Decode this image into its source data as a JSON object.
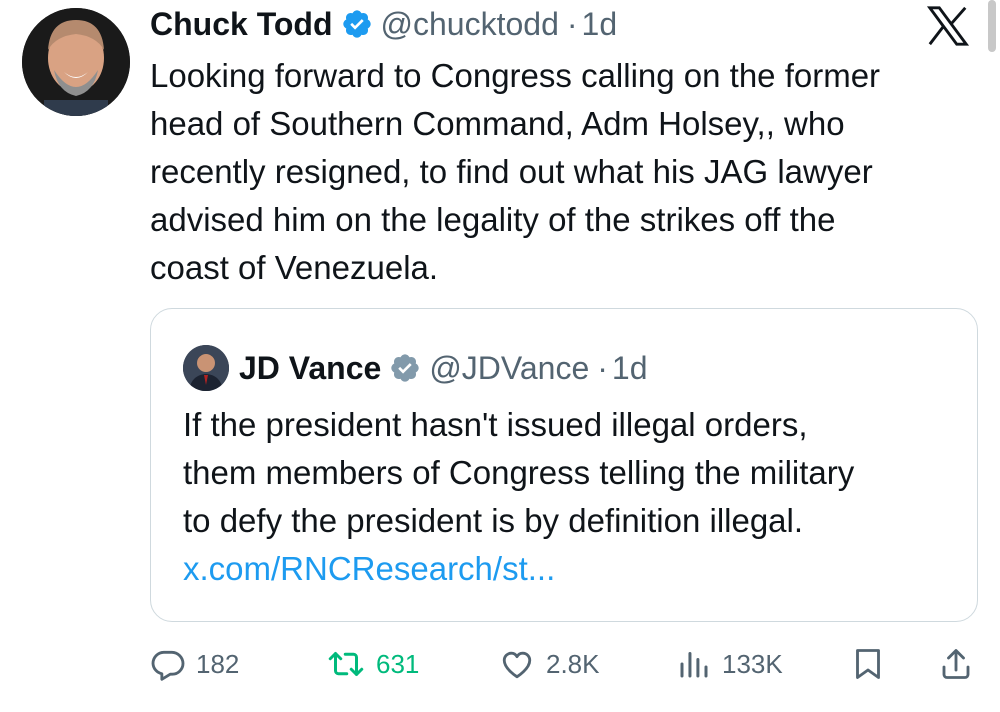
{
  "tweet": {
    "author_name": "Chuck Todd",
    "handle": "@chucktodd",
    "separator": "·",
    "time": "1d",
    "text": "Looking forward to Congress calling on the former\nhead of Southern Command, Adm Holsey,, who\nrecently resigned, to find out what his JAG lawyer\nadvised him on the legality of the strikes off the\ncoast of Venezuela.",
    "verified": true
  },
  "quote": {
    "author_name": "JD Vance",
    "handle": "@JDVance",
    "separator": "·",
    "time": "1d",
    "text": "If the president hasn't issued illegal orders,\nthem members of Congress telling the military\nto defy the president is by definition illegal.",
    "link": "x.com/RNCResearch/st...",
    "verified": true
  },
  "actions": {
    "replies": "182",
    "retweets": "631",
    "likes": "2.8K",
    "views": "133K"
  },
  "colors": {
    "verified_blue": "#1d9bf0",
    "quote_verified_gray": "#829aab",
    "retweet_green": "#00ba7c",
    "link_blue": "#1d9bf0",
    "secondary_text": "#536471"
  },
  "icons": {
    "platform": "x-logo-icon",
    "reply": "reply-icon",
    "retweet": "retweet-icon",
    "like": "heart-icon",
    "views": "views-chart-icon",
    "bookmark": "bookmark-icon",
    "share": "share-icon"
  }
}
